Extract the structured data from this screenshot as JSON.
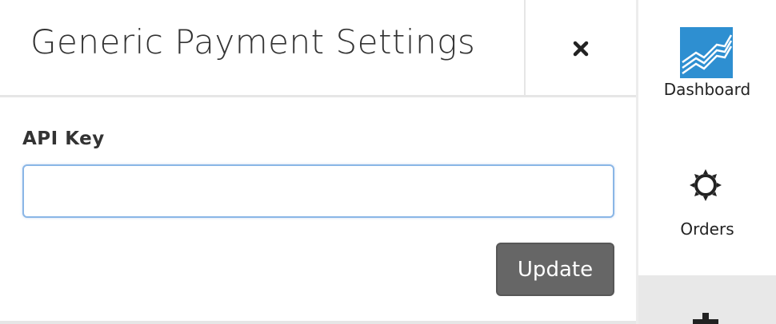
{
  "panel": {
    "title": "Generic Payment Settings",
    "close_icon": "close-icon",
    "api_key": {
      "label": "API Key",
      "value": "",
      "placeholder": ""
    },
    "update_label": "Update"
  },
  "sidebar": {
    "items": [
      {
        "label": "Dashboard",
        "icon": "dashboard-chart-icon"
      },
      {
        "label": "Orders",
        "icon": "gear-icon"
      },
      {
        "label": "",
        "icon": "plus-icon"
      }
    ]
  },
  "colors": {
    "dashboard_icon": "#2e8fd1",
    "update_button": "#666666",
    "input_border": "#8ab6e6"
  }
}
